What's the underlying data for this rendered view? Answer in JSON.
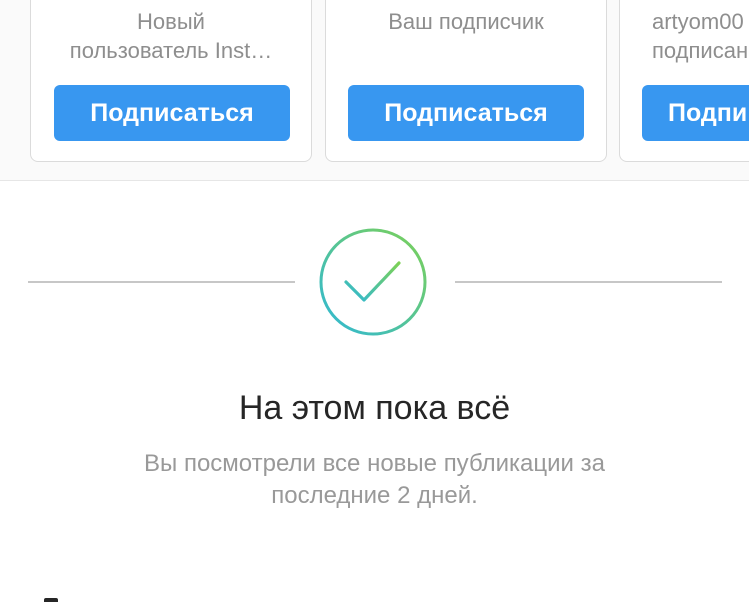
{
  "suggestions": {
    "cards": [
      {
        "subtitle_lines": [
          "Новый",
          "пользователь Inst…"
        ],
        "button_label": "Подписаться"
      },
      {
        "subtitle_lines": [
          "Ваш подписчик"
        ],
        "button_label": "Подписаться"
      },
      {
        "subtitle_lines": [
          "artyom00",
          "подписан"
        ],
        "button_label": "Подпи"
      }
    ]
  },
  "all_caught_up": {
    "title": "На этом пока всё",
    "subtitle_line1": "Вы посмотрели все новые публикации за",
    "subtitle_line2": "последние 2 дней."
  },
  "icons": {
    "check": "checkmark-circle-icon"
  },
  "colors": {
    "button_blue": "#3897f0",
    "gradient_start": "#2fb8d6",
    "gradient_end": "#7dd155",
    "muted_text": "#8e8e8e"
  }
}
